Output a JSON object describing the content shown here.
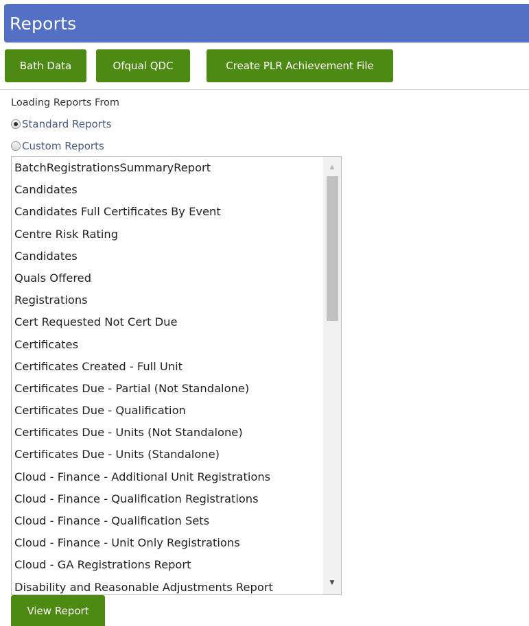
{
  "header": {
    "title": "Reports"
  },
  "toolbar": {
    "bath_label": "Bath Data",
    "qdc_label": "Ofqual QDC",
    "plr_label": "Create PLR Achievement File"
  },
  "form": {
    "loading_label": "Loading Reports From",
    "radios": [
      {
        "label": "Standard Reports",
        "checked": true
      },
      {
        "label": "Custom Reports",
        "checked": false
      }
    ]
  },
  "report_list": [
    "BatchRegistrationsSummaryReport",
    "Candidates",
    "Candidates Full Certificates By Event",
    "Centre Risk Rating",
    "Candidates",
    "Quals Offered",
    "Registrations",
    "Cert Requested Not Cert Due",
    "Certificates",
    "Certificates Created - Full Unit",
    "Certificates Due - Partial (Not Standalone)",
    "Certificates Due - Qualification",
    "Certificates Due - Units (Not Standalone)",
    "Certificates Due - Units (Standalone)",
    "Cloud - Finance - Additional Unit Registrations",
    "Cloud - Finance - Qualification Registrations",
    "Cloud - Finance - Qualification Sets",
    "Cloud - Finance - Unit Only Registrations",
    "Cloud - GA Registrations Report",
    "Disability and Reasonable Adjustments Report"
  ],
  "scroll": {
    "up_icon": "▲",
    "down_icon": "▼"
  },
  "actions": {
    "view_label": "View Report"
  },
  "colors": {
    "header": "#5470c4",
    "button": "#4d8a11",
    "radio_text": "#4a5a86"
  }
}
